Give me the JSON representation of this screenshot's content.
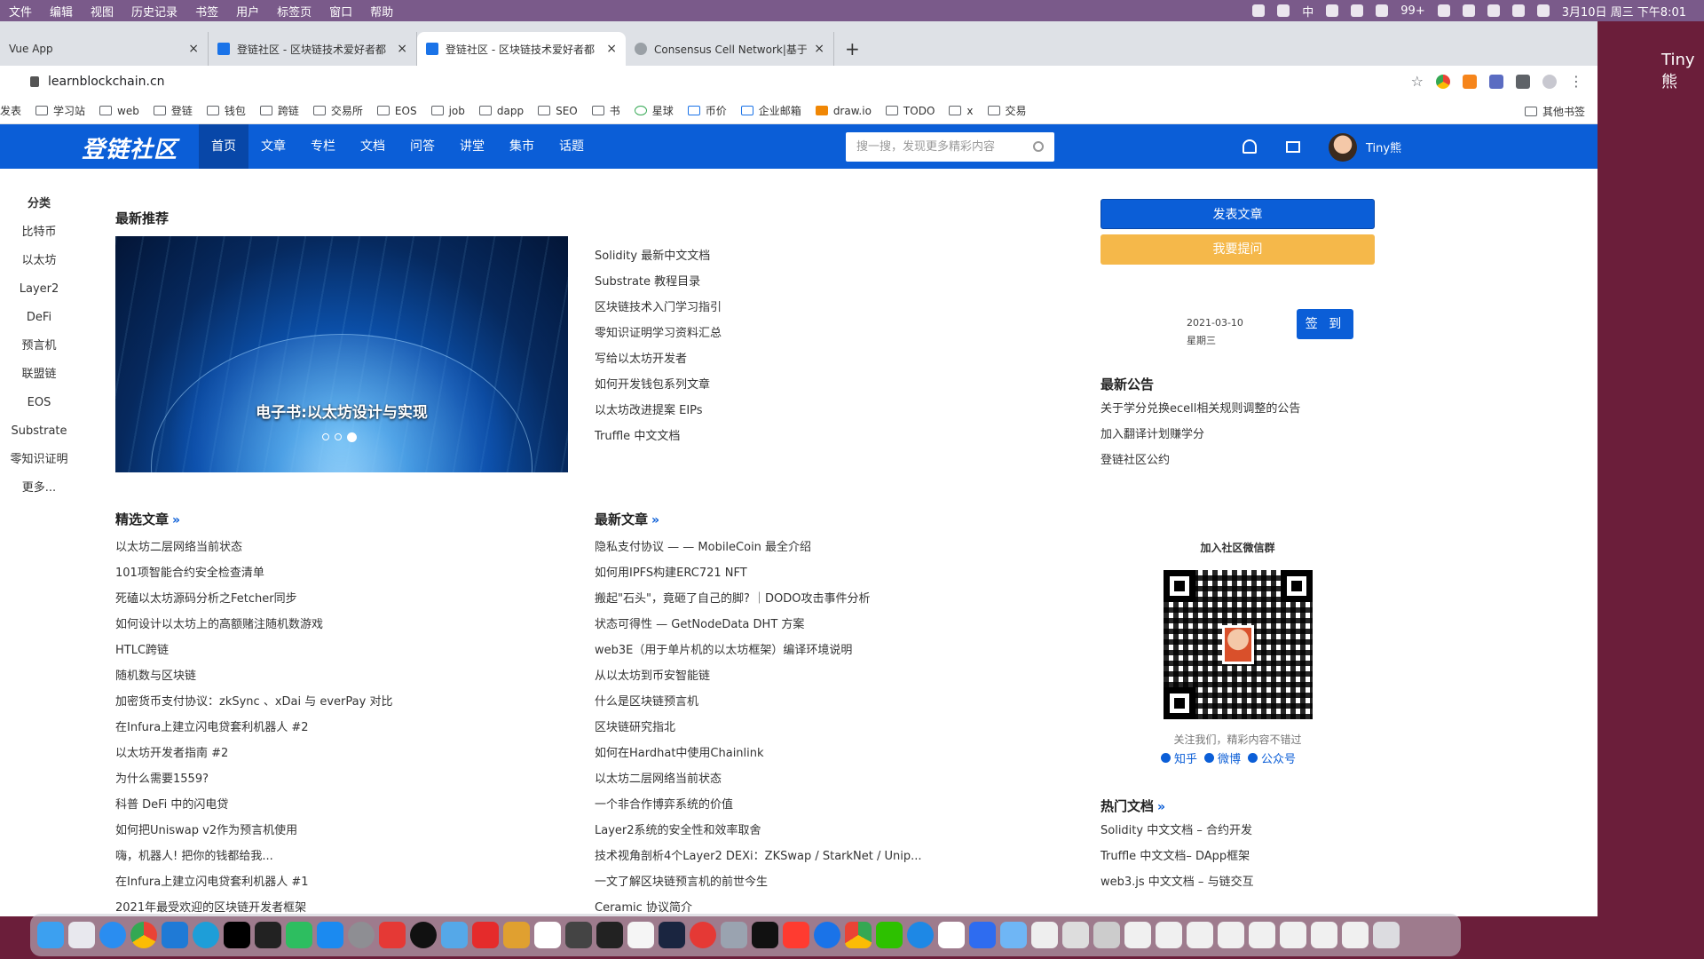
{
  "menubar": {
    "items": [
      "文件",
      "编辑",
      "视图",
      "历史记录",
      "书签",
      "用户",
      "标签页",
      "窗口",
      "帮助"
    ],
    "input_method": "中",
    "badge": "99+",
    "clock": "3月10日 周三 下午8:01"
  },
  "tabs": [
    {
      "title": "Vue App"
    },
    {
      "title": "登链社区 - 区块链技术爱好者都"
    },
    {
      "title": "登链社区 - 区块链技术爱好者都"
    },
    {
      "title": "Consensus Cell Network|基于"
    }
  ],
  "new_tab": "+",
  "address": {
    "url": "learnblockchain.cn"
  },
  "bookmarks": {
    "items": [
      "发表",
      "学习站",
      "web",
      "登链",
      "钱包",
      "跨链",
      "交易所",
      "EOS",
      "job",
      "dapp",
      "SEO",
      "书",
      "星球",
      "币价",
      "企业邮箱",
      "draw.io",
      "TODO",
      "x",
      "交易"
    ],
    "other": "其他书签"
  },
  "site": {
    "logo": "登链社区",
    "nav": [
      "首页",
      "文章",
      "专栏",
      "文档",
      "问答",
      "讲堂",
      "集市",
      "话题"
    ],
    "search_placeholder": "搜一搜，发现更多精彩内容",
    "username": "Tiny熊"
  },
  "sidebar": {
    "title": "分类",
    "items": [
      "比特币",
      "以太坊",
      "Layer2",
      "DeFi",
      "预言机",
      "联盟链",
      "EOS",
      "Substrate",
      "零知识证明",
      "更多..."
    ]
  },
  "featured": {
    "title": "最新推荐",
    "banner_caption": "电子书:以太坊设计与实现",
    "links": [
      "Solidity 最新中文文档",
      "Substrate 教程目录",
      "区块链技术入门学习指引",
      "零知识证明学习资料汇总",
      "写给以太坊开发者",
      "如何开发钱包系列文章",
      "以太坊改进提案 EIPs",
      "Truffle 中文文档"
    ]
  },
  "selected_articles": {
    "title": "精选文章",
    "arrow": "»",
    "items": [
      "以太坊二层网络当前状态",
      "101项智能合约安全检查清单",
      "死磕以太坊源码分析之Fetcher同步",
      "如何设计以太坊上的高额赌注随机数游戏",
      "HTLC跨链",
      "随机数与区块链",
      "加密货币支付协议：zkSync 、xDai 与 everPay 对比",
      "在Infura上建立闪电贷套利机器人 #2",
      "以太坊开发者指南 #2",
      "为什么需要1559?",
      "科普 DeFi 中的闪电贷",
      "如何把Uniswap v2作为预言机使用",
      "嗨，机器人! 把你的钱都给我...",
      "在Infura上建立闪电贷套利机器人 #1",
      "2021年最受欢迎的区块链开发者框架"
    ]
  },
  "latest_articles": {
    "title": "最新文章",
    "arrow": "»",
    "items": [
      "隐私支付协议 — — MobileCoin 最全介绍",
      "如何用IPFS构建ERC721 NFT",
      "搬起\"石头\"，竟砸了自己的脚? ｜DODO攻击事件分析",
      "状态可得性 — GetNodeData DHT 方案",
      "web3E（用于单片机的以太坊框架）编译环境说明",
      "从以太坊到币安智能链",
      "什么是区块链预言机",
      "区块链研究指北",
      "如何在Hardhat中使用Chainlink",
      "以太坊二层网络当前状态",
      "一个非合作博弈系统的价值",
      "Layer2系统的安全性和效率取舍",
      "技术视角剖析4个Layer2 DEXi：ZKSwap / StarkNet / Unip...",
      "一文了解区块链预言机的前世今生",
      "Ceramic 协议简介"
    ]
  },
  "actions": {
    "publish": "发表文章",
    "ask": "我要提问"
  },
  "checkin": {
    "date": "2021-03-10",
    "weekday": "星期三",
    "button": "签 到"
  },
  "announcements": {
    "title": "最新公告",
    "items": [
      "关于学分兑换ecell相关规则调整的公告",
      "加入翻译计划赚学分",
      "登链社区公约"
    ]
  },
  "wechat": {
    "title": "加入社区微信群",
    "follow_text": "关注我们，精彩内容不错过",
    "links": [
      "知乎",
      "微博",
      "公众号"
    ]
  },
  "hot_docs": {
    "title": "热门文档",
    "arrow": "»",
    "items": [
      "Solidity 中文文档 – 合约开发",
      "Truffle 中文文档– DApp框架",
      "web3.js 中文文档 – 与链交互"
    ]
  },
  "overlay_text": "Tiny熊",
  "colors": {
    "brand": "#0b5ed7",
    "orange": "#f5b84a",
    "menubar": "#7a5a8a"
  }
}
